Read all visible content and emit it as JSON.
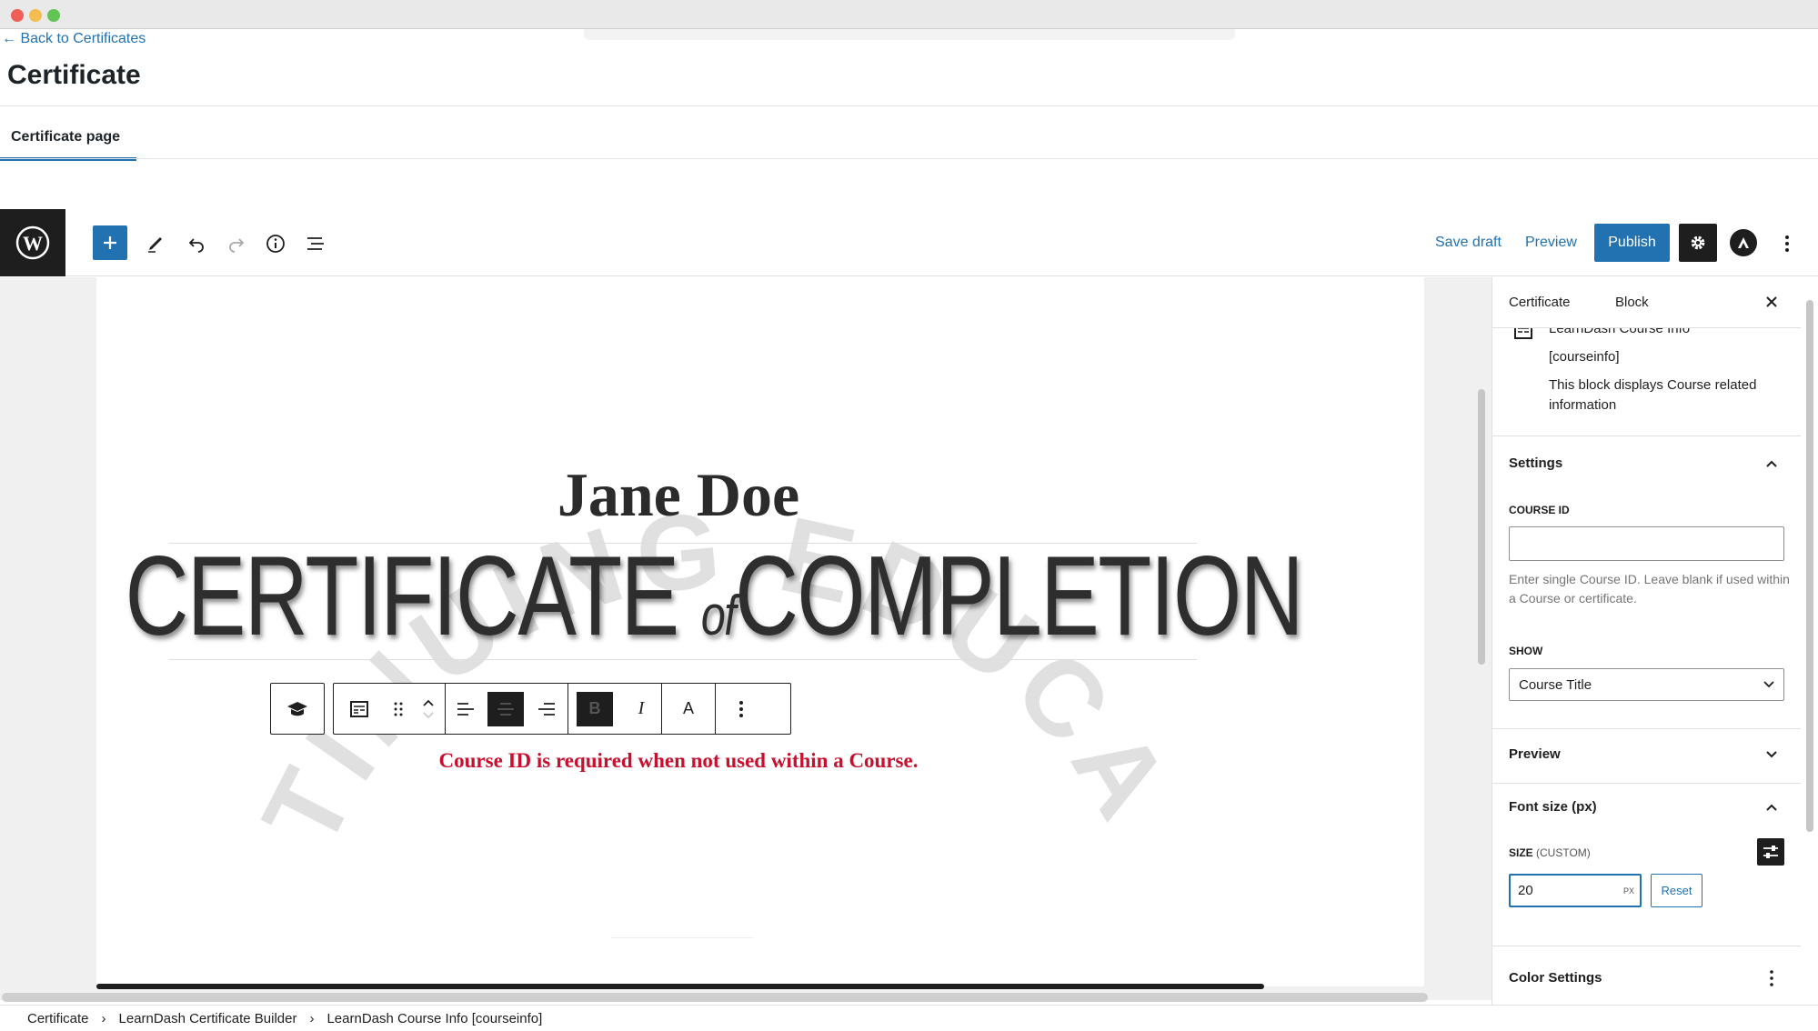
{
  "window": {
    "dots": [
      "#ed5f57",
      "#f5bd4f",
      "#61c454"
    ]
  },
  "header": {
    "back_link": "← Back to Certificates",
    "page_title": "Certificate",
    "tab": "Certificate page"
  },
  "toolbar": {
    "save_draft": "Save draft",
    "preview": "Preview",
    "publish": "Publish"
  },
  "certificate": {
    "watermark_top": "CONTINUING EDUCATION",
    "name": "Jane Doe",
    "title_part1": "CERTIFICATE",
    "title_of": "of",
    "title_part2": "COMPLETION",
    "error": "Course ID is required when not used within a Course."
  },
  "block_toolbar": {
    "align_text_label": "A"
  },
  "sidebar": {
    "tab_certificate": "Certificate",
    "tab_block": "Block",
    "block_name": "LearnDash Course Info",
    "block_shortcode": "[courseinfo]",
    "block_desc": "This block displays Course related information",
    "settings_title": "Settings",
    "course_id_label": "COURSE ID",
    "course_id_value": "",
    "course_id_help": "Enter single Course ID. Leave blank if used within a Course or certificate.",
    "show_label": "SHOW",
    "show_value": "Course Title",
    "preview_title": "Preview",
    "font_size_title": "Font size (px)",
    "size_label": "SIZE",
    "size_custom": "(CUSTOM)",
    "size_value": "20",
    "size_unit": "PX",
    "reset": "Reset",
    "color_title": "Color Settings"
  },
  "breadcrumb": [
    "Certificate",
    "LearnDash Certificate Builder",
    "LearnDash Course Info [courseinfo]"
  ]
}
